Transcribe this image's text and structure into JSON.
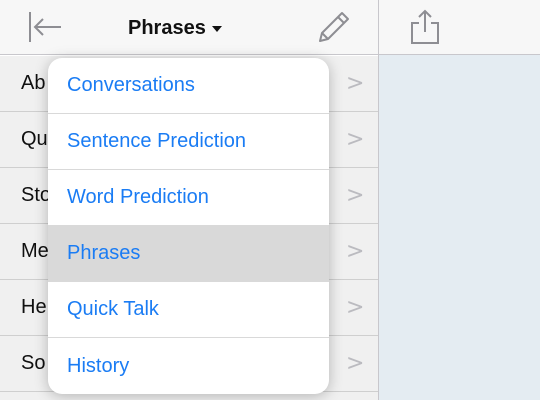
{
  "header": {
    "title": "Phrases"
  },
  "list": {
    "rows": [
      {
        "label": "Ab"
      },
      {
        "label": "Qu"
      },
      {
        "label": "Sto"
      },
      {
        "label": "Me"
      },
      {
        "label": "He"
      },
      {
        "label": "So"
      }
    ]
  },
  "menu": {
    "items": [
      {
        "label": "Conversations"
      },
      {
        "label": "Sentence Prediction"
      },
      {
        "label": "Word Prediction"
      },
      {
        "label": "Phrases",
        "selected": true
      },
      {
        "label": "Quick Talk"
      },
      {
        "label": "History"
      }
    ],
    "chevron_glyph": ">"
  },
  "colors": {
    "accent": "#1a7cf4",
    "right_pane": "#e4ecf2",
    "nav_bar": "#f7f7f7",
    "selected_item": "#d9d9d9"
  },
  "icons": [
    "collapse-sidebar-icon",
    "edit-icon",
    "share-icon",
    "chevron-right-icon",
    "caret-down-icon"
  ]
}
